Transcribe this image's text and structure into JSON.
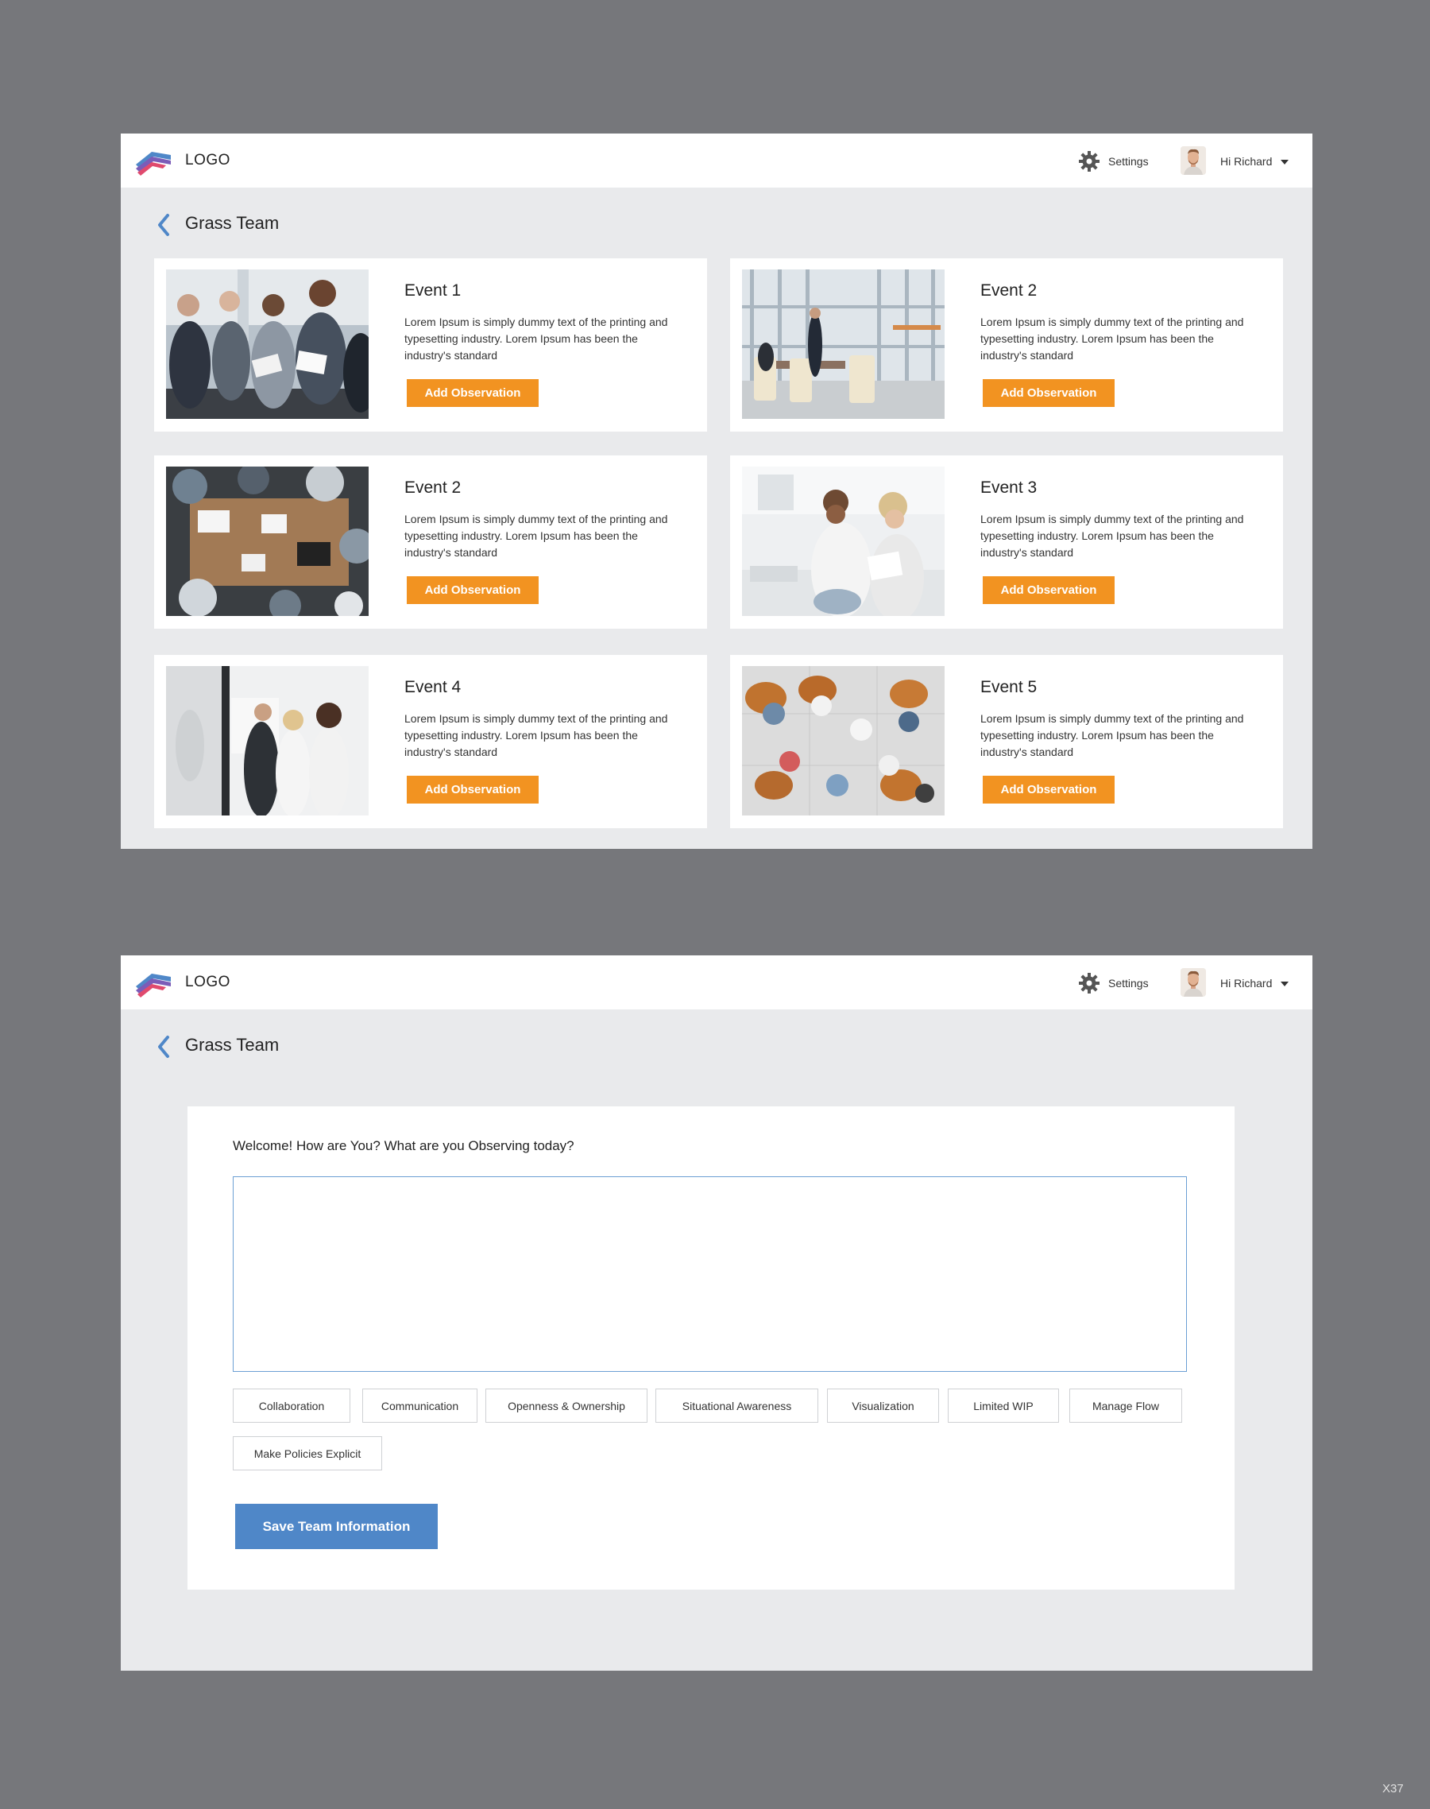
{
  "app": {
    "logo_text": "LOGO",
    "settings_label": "Settings",
    "user_greeting": "Hi Richard",
    "icons": [
      "logo-mark",
      "gear-icon",
      "avatar",
      "caret-down-icon",
      "back-chevron-icon"
    ]
  },
  "screen1": {
    "team_title": "Grass Team",
    "events": [
      {
        "title": "Event 1",
        "description": "Lorem Ipsum is simply dummy text of the printing and typesetting industry. Lorem Ipsum has been the industry's standard",
        "button": "Add Observation"
      },
      {
        "title": "Event 2",
        "description": "Lorem Ipsum is simply dummy text of the printing and typesetting industry. Lorem Ipsum has been the industry's standard",
        "button": "Add Observation"
      },
      {
        "title": "Event 2",
        "description": "Lorem Ipsum is simply dummy text of the printing and typesetting industry. Lorem Ipsum has been the industry's standard",
        "button": "Add Observation"
      },
      {
        "title": "Event 3",
        "description": "Lorem Ipsum is simply dummy text of the printing and typesetting industry. Lorem Ipsum has been the industry's standard",
        "button": "Add Observation"
      },
      {
        "title": "Event 4",
        "description": "Lorem Ipsum is simply dummy text of the printing and typesetting industry. Lorem Ipsum has been the industry's standard",
        "button": "Add Observation"
      },
      {
        "title": "Event 5",
        "description": "Lorem Ipsum is simply dummy text of the printing and typesetting industry. Lorem Ipsum has been the industry's standard",
        "button": "Add Observation"
      }
    ]
  },
  "screen2": {
    "team_title": "Grass Team",
    "prompt": "Welcome! How are You? What are you Observing today?",
    "textarea_value": "",
    "tags": [
      "Collaboration",
      "Communication",
      "Openness & Ownership",
      "Situational Awareness",
      "Visualization",
      "Limited WIP",
      "Manage Flow",
      "Make Policies Explicit"
    ],
    "save_button": "Save Team Information"
  },
  "colors": {
    "page_bg": "#76777b",
    "screen_bg": "#e9eaec",
    "accent_orange": "#f29321",
    "accent_blue": "#4f87c8",
    "textarea_border": "#6b9fd4"
  },
  "corner_mark": "X37"
}
